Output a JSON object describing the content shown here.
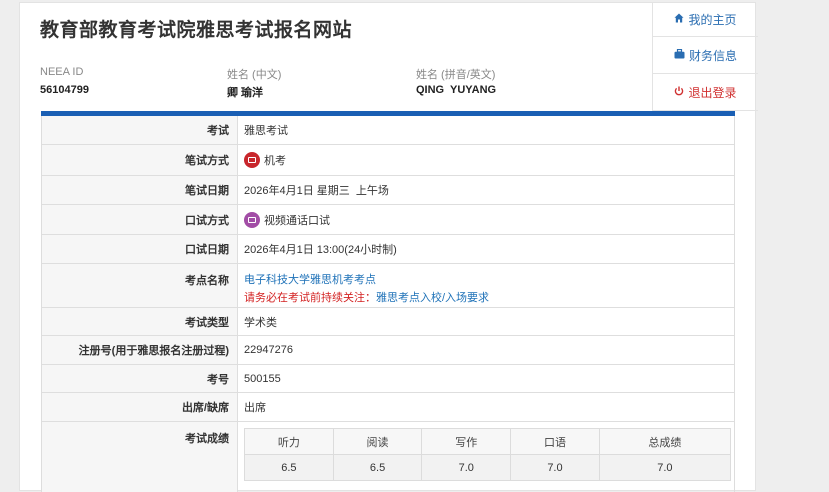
{
  "header": {
    "site_title": "教育部教育考试院雅思考试报名网站",
    "neea_id_label": "NEEA ID",
    "neea_id_value": "56104799",
    "name_cn_label": "姓名 (中文)",
    "name_cn_value": "卿 瑜洋",
    "name_en_label": "姓名 (拼音/英文)",
    "name_en_value": "QING  YUYANG"
  },
  "nav": {
    "home": "我的主页",
    "finance": "财务信息",
    "logout": "退出登录"
  },
  "details": {
    "exam_label": "考试",
    "exam_value": "雅思考试",
    "written_mode_label": "笔试方式",
    "written_mode_value": "机考",
    "written_date_label": "笔试日期",
    "written_date_value": "2026年4月1日 星期三  上午场",
    "speaking_mode_label": "口试方式",
    "speaking_mode_value": "视频通话口试",
    "speaking_date_label": "口试日期",
    "speaking_date_value": "2026年4月1日 13:00(24小时制)",
    "center_label": "考点名称",
    "center_value": "电子科技大学雅思机考考点",
    "center_notice": "请务必在考试前持续关注：",
    "center_link": "雅思考点入校/入场要求",
    "type_label": "考试类型",
    "type_value": "学术类",
    "reg_label": "注册号(用于雅思报名注册过程)",
    "reg_value": "22947276",
    "candidate_label": "考号",
    "candidate_value": "500155",
    "attendance_label": "出席/缺席",
    "attendance_value": "出席",
    "scores_label": "考试成绩"
  },
  "scores": {
    "headers": [
      "听力",
      "阅读",
      "写作",
      "口语",
      "总成绩"
    ],
    "values": [
      "6.5",
      "6.5",
      "7.0",
      "7.0",
      "7.0"
    ]
  },
  "colors": {
    "accent_bar": "#1a5fb4",
    "link": "#1f72b8",
    "warning": "#d32222",
    "computer_badge": "#c8262c",
    "video_badge": "#a24da6"
  },
  "icons": {
    "home": "home-icon",
    "finance": "briefcase-icon",
    "logout": "power-icon",
    "computer": "monitor-icon",
    "video": "video-camera-icon"
  }
}
